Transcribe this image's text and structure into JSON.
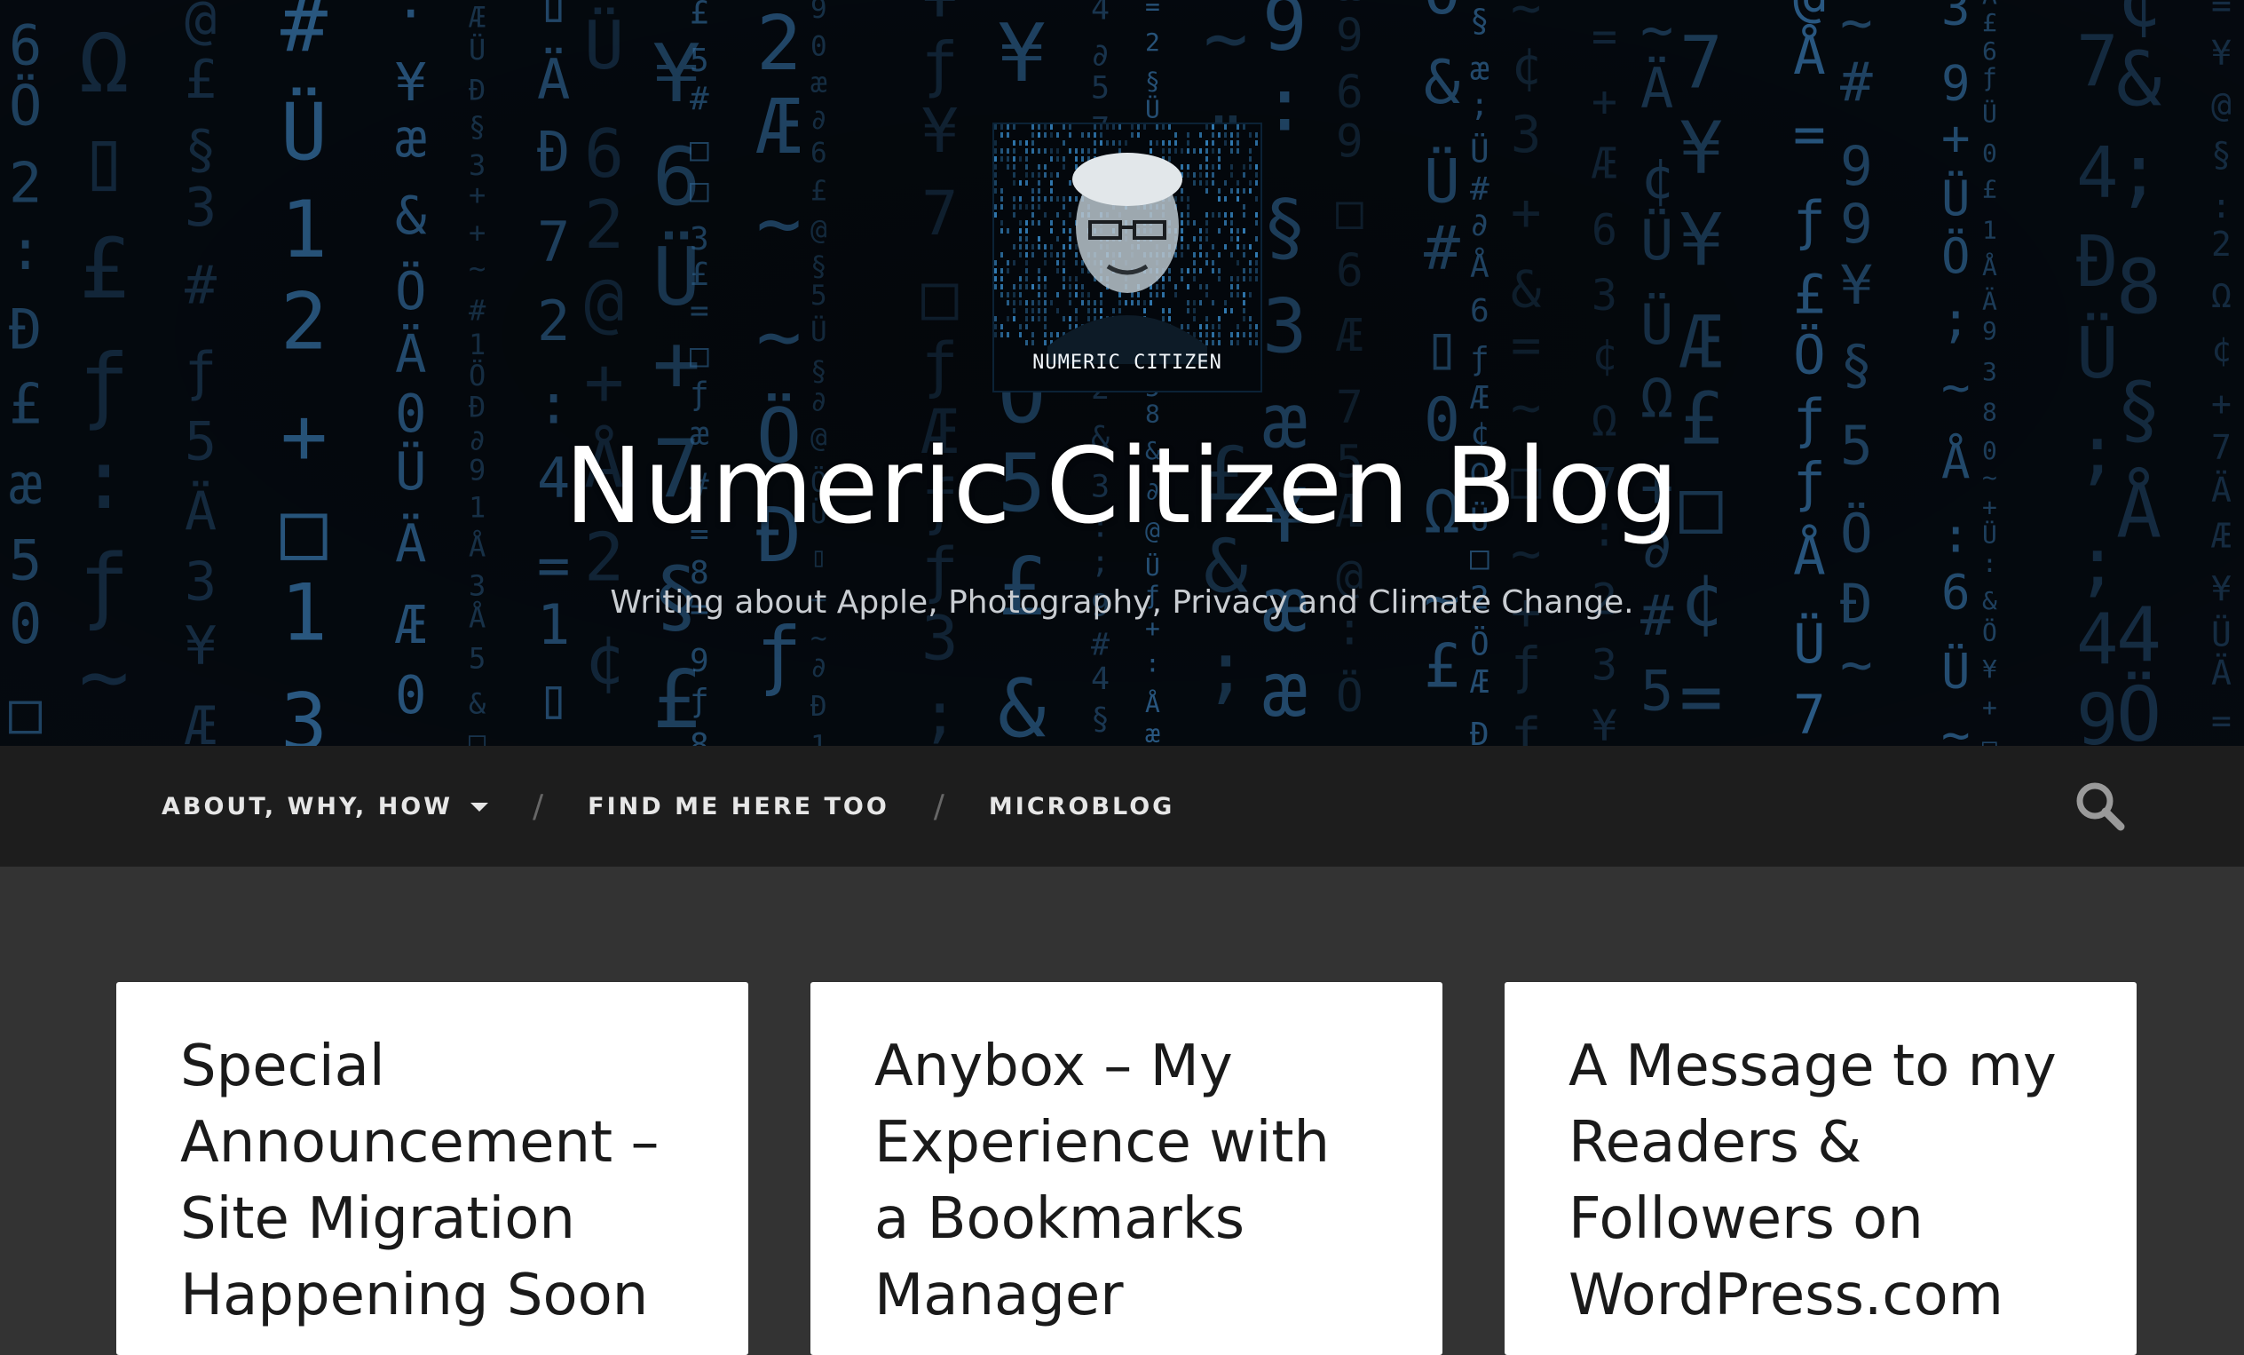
{
  "header": {
    "logo_text": "NUMERIC CITIZEN",
    "title": "Numeric Citizen Blog",
    "description": "Writing about Apple, Photography, Privacy and Climate Change."
  },
  "nav": {
    "items": [
      {
        "label": "ABOUT, WHY, HOW",
        "has_dropdown": true
      },
      {
        "label": "FIND ME HERE TOO",
        "has_dropdown": false
      },
      {
        "label": "MICROBLOG",
        "has_dropdown": false
      }
    ],
    "separator": "/",
    "search_icon": "search-icon"
  },
  "posts": [
    {
      "title": "Special\nAnnouncement –\nSite Migration\nHappening Soon"
    },
    {
      "title": "Anybox – My\nExperience with\na Bookmarks\nManager"
    },
    {
      "title": "A Message to my\nReaders &\nFollowers on\nWordPress.com"
    }
  ],
  "colors": {
    "header_bg": "#050a10",
    "nav_bg": "#1d1d1d",
    "content_bg": "#333333",
    "card_bg": "#ffffff",
    "matrix_blue": "#3f86c4"
  }
}
